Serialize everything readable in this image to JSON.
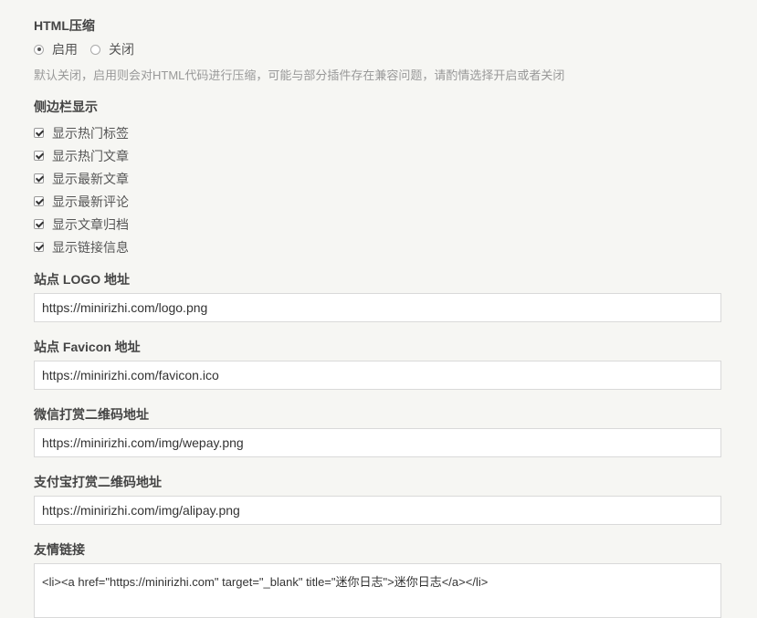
{
  "html_compress": {
    "title": "HTML压缩",
    "options": [
      {
        "label": "启用",
        "checked": true
      },
      {
        "label": "关闭",
        "checked": false
      }
    ],
    "hint": "默认关闭，启用则会对HTML代码进行压缩，可能与部分插件存在兼容问题，请酌情选择开启或者关闭"
  },
  "sidebar": {
    "title": "侧边栏显示",
    "items": [
      {
        "label": "显示热门标签",
        "checked": true
      },
      {
        "label": "显示热门文章",
        "checked": true
      },
      {
        "label": "显示最新文章",
        "checked": true
      },
      {
        "label": "显示最新评论",
        "checked": true
      },
      {
        "label": "显示文章归档",
        "checked": true
      },
      {
        "label": "显示链接信息",
        "checked": true
      }
    ]
  },
  "logo": {
    "title": "站点 LOGO 地址",
    "value": "https://minirizhi.com/logo.png"
  },
  "favicon": {
    "title": "站点 Favicon 地址",
    "value": "https://minirizhi.com/favicon.ico"
  },
  "wechat_qr": {
    "title": "微信打赏二维码地址",
    "value": "https://minirizhi.com/img/wepay.png"
  },
  "alipay_qr": {
    "title": "支付宝打赏二维码地址",
    "value": "https://minirizhi.com/img/alipay.png"
  },
  "friend_links": {
    "title": "友情链接",
    "value": "<li><a href=\"https://minirizhi.com\" target=\"_blank\" title=\"迷你日志\">迷你日志</a></li>"
  }
}
